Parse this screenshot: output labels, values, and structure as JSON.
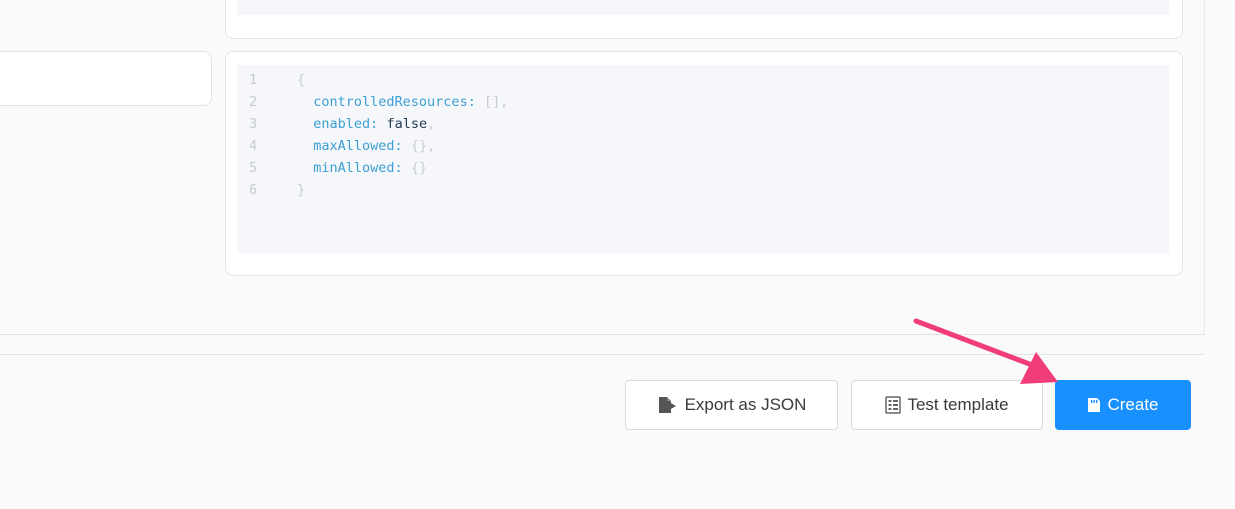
{
  "editor": {
    "lines": [
      {
        "num": "1",
        "indent": "",
        "key": "",
        "sep": "",
        "value": "",
        "punct": "{"
      },
      {
        "num": "2",
        "indent": "  ",
        "key": "controlledResources",
        "sep": ": ",
        "value": "",
        "punct": "[],"
      },
      {
        "num": "3",
        "indent": "  ",
        "key": "enabled",
        "sep": ": ",
        "value": "false",
        "punct": ","
      },
      {
        "num": "4",
        "indent": "  ",
        "key": "maxAllowed",
        "sep": ": ",
        "value": "",
        "punct": "{},"
      },
      {
        "num": "5",
        "indent": "  ",
        "key": "minAllowed",
        "sep": ": ",
        "value": "",
        "punct": "{}"
      },
      {
        "num": "6",
        "indent": "",
        "key": "",
        "sep": "",
        "value": "",
        "punct": "}"
      }
    ]
  },
  "footer": {
    "export_label": "Export as JSON",
    "export_icon": "file-export-icon",
    "test_label": "Test template",
    "test_icon": "list-checks-icon",
    "create_label": "Create",
    "create_icon": "save-icon"
  },
  "colors": {
    "primary": "#1890ff",
    "annotation_arrow": "#f03d7a",
    "code_key": "#3d9fd3",
    "code_value": "#1e3a56"
  }
}
